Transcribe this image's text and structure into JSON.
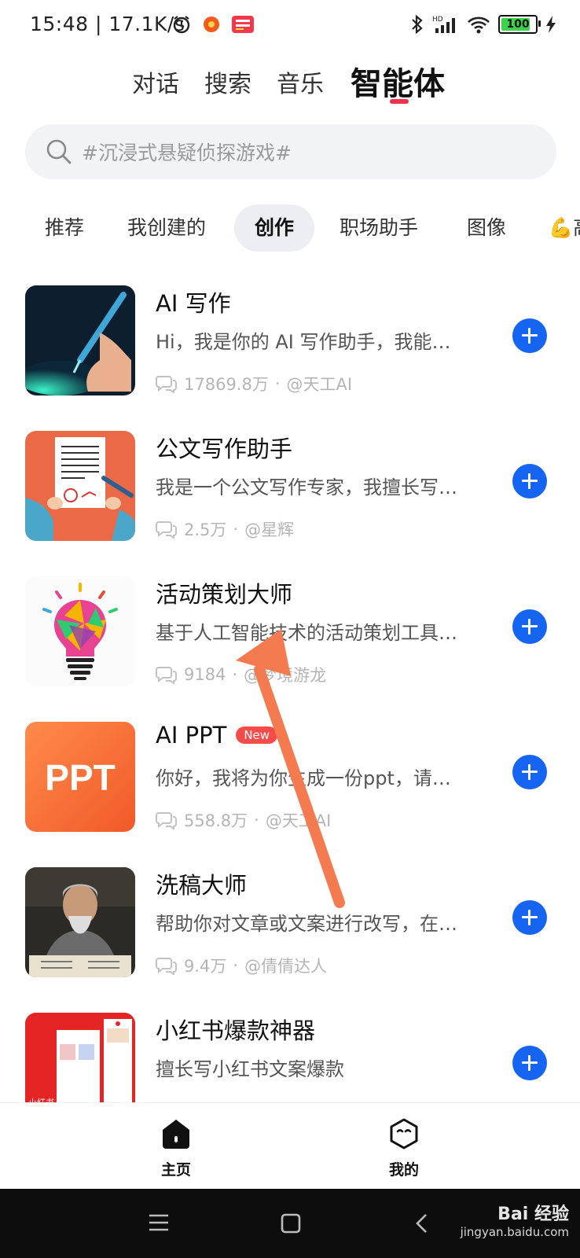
{
  "status_bar": {
    "time": "15:48 | 17.1K/s",
    "battery": "100"
  },
  "top_tabs": [
    {
      "label": "对话"
    },
    {
      "label": "搜索"
    },
    {
      "label": "音乐"
    },
    {
      "label": "智能体"
    }
  ],
  "search": {
    "placeholder": "#沉浸式悬疑侦探游戏#"
  },
  "categories": [
    {
      "label": "推荐"
    },
    {
      "label": "我创建的"
    },
    {
      "label": "创作"
    },
    {
      "label": "职场助手"
    },
    {
      "label": "图像"
    },
    {
      "label": "💪高"
    }
  ],
  "items": [
    {
      "title": "AI 写作",
      "desc": "Hi，我是你的 AI 写作助手，我能…",
      "count": "17869.8万",
      "author": "@天工AI",
      "badge": ""
    },
    {
      "title": "公文写作助手",
      "desc": "我是一个公文写作专家，我擅长写…",
      "count": "2.5万",
      "author": "@星辉",
      "badge": ""
    },
    {
      "title": "活动策划大师",
      "desc": "基于人工智能技术的活动策划工具…",
      "count": "9184",
      "author": "@梦境游龙",
      "badge": ""
    },
    {
      "title": "AI PPT",
      "desc": "你好，我将为你生成一份ppt，请…",
      "count": "558.8万",
      "author": "@天工AI",
      "badge": "New"
    },
    {
      "title": "洗稿大师",
      "desc": "帮助你对文章或文案进行改写，在…",
      "count": "9.4万",
      "author": "@倩倩达人",
      "badge": ""
    },
    {
      "title": "小红书爆款神器",
      "desc": "擅长写小红书文案爆款",
      "count": "",
      "author": "",
      "badge": ""
    }
  ],
  "thumb_text": {
    "ppt": "PPT",
    "xhs": "小红书"
  },
  "bottom_nav": {
    "home": "主页",
    "mine": "我的"
  },
  "watermark": {
    "brand": "Bai 经验",
    "url": "jingyan.baidu.com"
  },
  "colors": {
    "accent": "#1565f2",
    "tab_indicator": "#f0314e",
    "arrow": "#f47a50"
  }
}
